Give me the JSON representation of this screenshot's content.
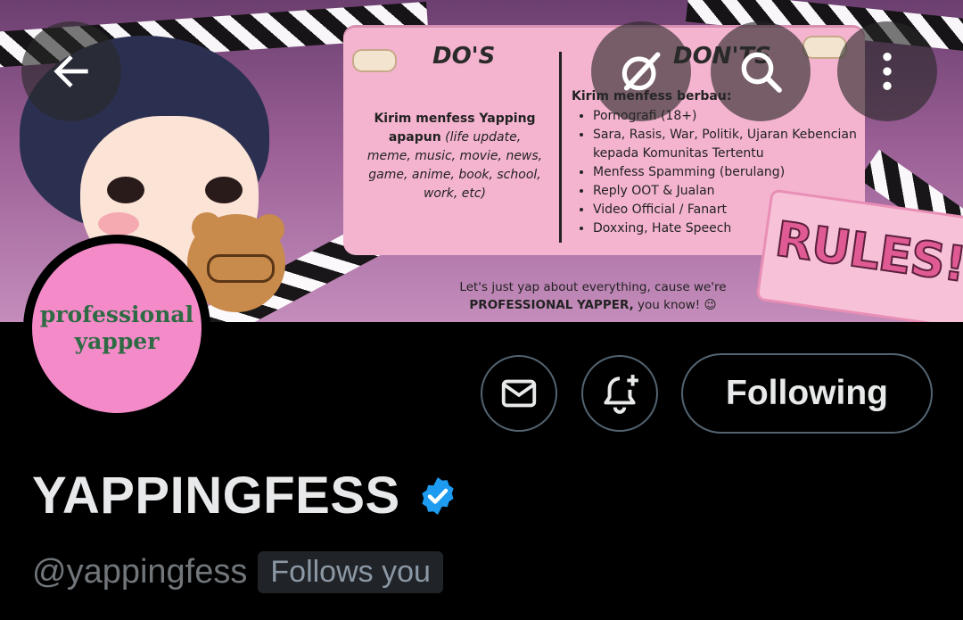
{
  "banner": {
    "dos_title": "DO'S",
    "donts_title": "DON'TS",
    "dos_bold": "Kirim menfess Yapping apapun",
    "dos_italic": "(life update, meme, music, movie, news, game, anime, book, school, work, etc)",
    "donts_intro": "Kirim menfess berbau:",
    "donts_items": [
      "Pornografi (18+)",
      "Sara, Rasis, War, Politik, Ujaran Kebencian kepada Komunitas Tertentu",
      "Menfess Spamming (berulang)",
      "Reply OOT & Jualan",
      "Video Official / Fanart",
      "Doxxing, Hate Speech"
    ],
    "tagline_1": "Let's just yap about everything, cause we're",
    "tagline_bold": "PROFESSIONAL YAPPER,",
    "tagline_2": " you know! 😉",
    "rules_label": "RULES!"
  },
  "avatar": {
    "line1": "professional",
    "line2": "yapper"
  },
  "actions": {
    "following_label": "Following"
  },
  "profile": {
    "display_name": "YAPPINGFESS",
    "handle": "@yappingfess",
    "follows_badge": "Follows you"
  },
  "colors": {
    "verified": "#1d9bf0",
    "avatar_bg": "#f48ac8",
    "text_primary": "#e7e9ea",
    "text_secondary": "#71767b"
  },
  "icons": {
    "back": "arrow-left-icon",
    "grok": "grok-icon",
    "search": "search-icon",
    "more": "more-vertical-icon",
    "message": "envelope-icon",
    "notify": "bell-plus-icon",
    "verified": "verified-badge-icon"
  }
}
